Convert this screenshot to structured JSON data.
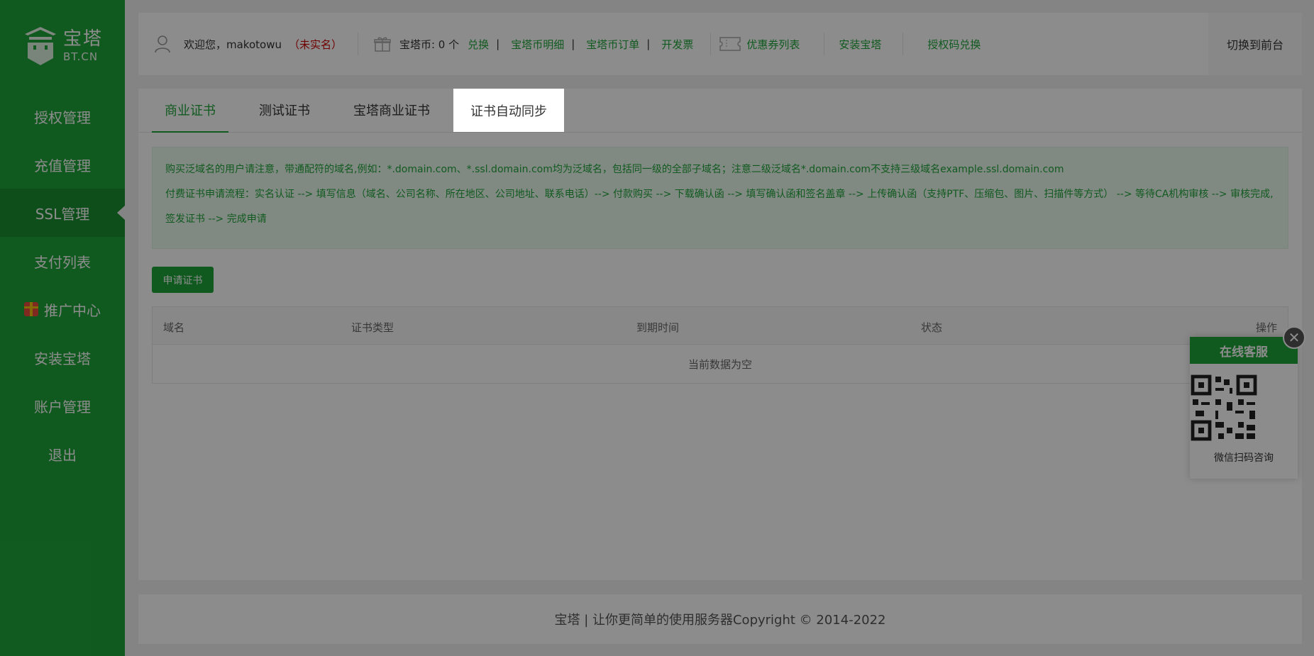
{
  "sidebar": {
    "logo_cn": "宝塔",
    "logo_en": "BT.CN",
    "items": [
      {
        "label": "授权管理"
      },
      {
        "label": "充值管理"
      },
      {
        "label": "SSL管理"
      },
      {
        "label": "支付列表"
      },
      {
        "label": "推广中心"
      },
      {
        "label": "安装宝塔"
      },
      {
        "label": "账户管理"
      },
      {
        "label": "退出"
      }
    ]
  },
  "topbar": {
    "welcome": "欢迎您，makotowu",
    "unverified": "（未实名）",
    "coins_label": "宝塔币: 0 个",
    "exchange": "兑换",
    "coin_detail": "宝塔币明细",
    "coin_orders": "宝塔币订单",
    "invoice": "开发票",
    "coupon_list": "优惠券列表",
    "install": "安装宝塔",
    "auth_code": "授权码兑换",
    "switch_front": "切换到前台"
  },
  "tabs": [
    {
      "label": "商业证书"
    },
    {
      "label": "测试证书"
    },
    {
      "label": "宝塔商业证书"
    },
    {
      "label": "证书自动同步"
    }
  ],
  "notice": {
    "line1": "购买泛域名的用户请注意，带通配符的域名,例如：*.domain.com、*.ssl.domain.com均为泛域名，包括同一级的全部子域名；注意二级泛域名*.domain.com不支持三级域名example.ssl.domain.com",
    "line2": "付费证书申请流程：实名认证 --> 填写信息（域名、公司名称、所在地区、公司地址、联系电话）--> 付款购买 --> 下载确认函 --> 填写确认函和签名盖章 --> 上传确认函（支持PTF、压缩包、图片、扫描件等方式） --> 等待CA机构审核 --> 审核完成,签发证书 --> 完成申请"
  },
  "apply_button": "申请证书",
  "table": {
    "headers": [
      "域名",
      "证书类型",
      "到期时间",
      "状态",
      "操作"
    ],
    "empty_text": "当前数据为空"
  },
  "footer": "宝塔 | 让你更简单的使用服务器Copyright © 2014-2022",
  "service": {
    "title": "在线客服",
    "caption": "微信扫码咨询",
    "close_symbol": "✕"
  },
  "colors": {
    "brand_green": "#20a53a",
    "warning_red": "#cc0000"
  }
}
